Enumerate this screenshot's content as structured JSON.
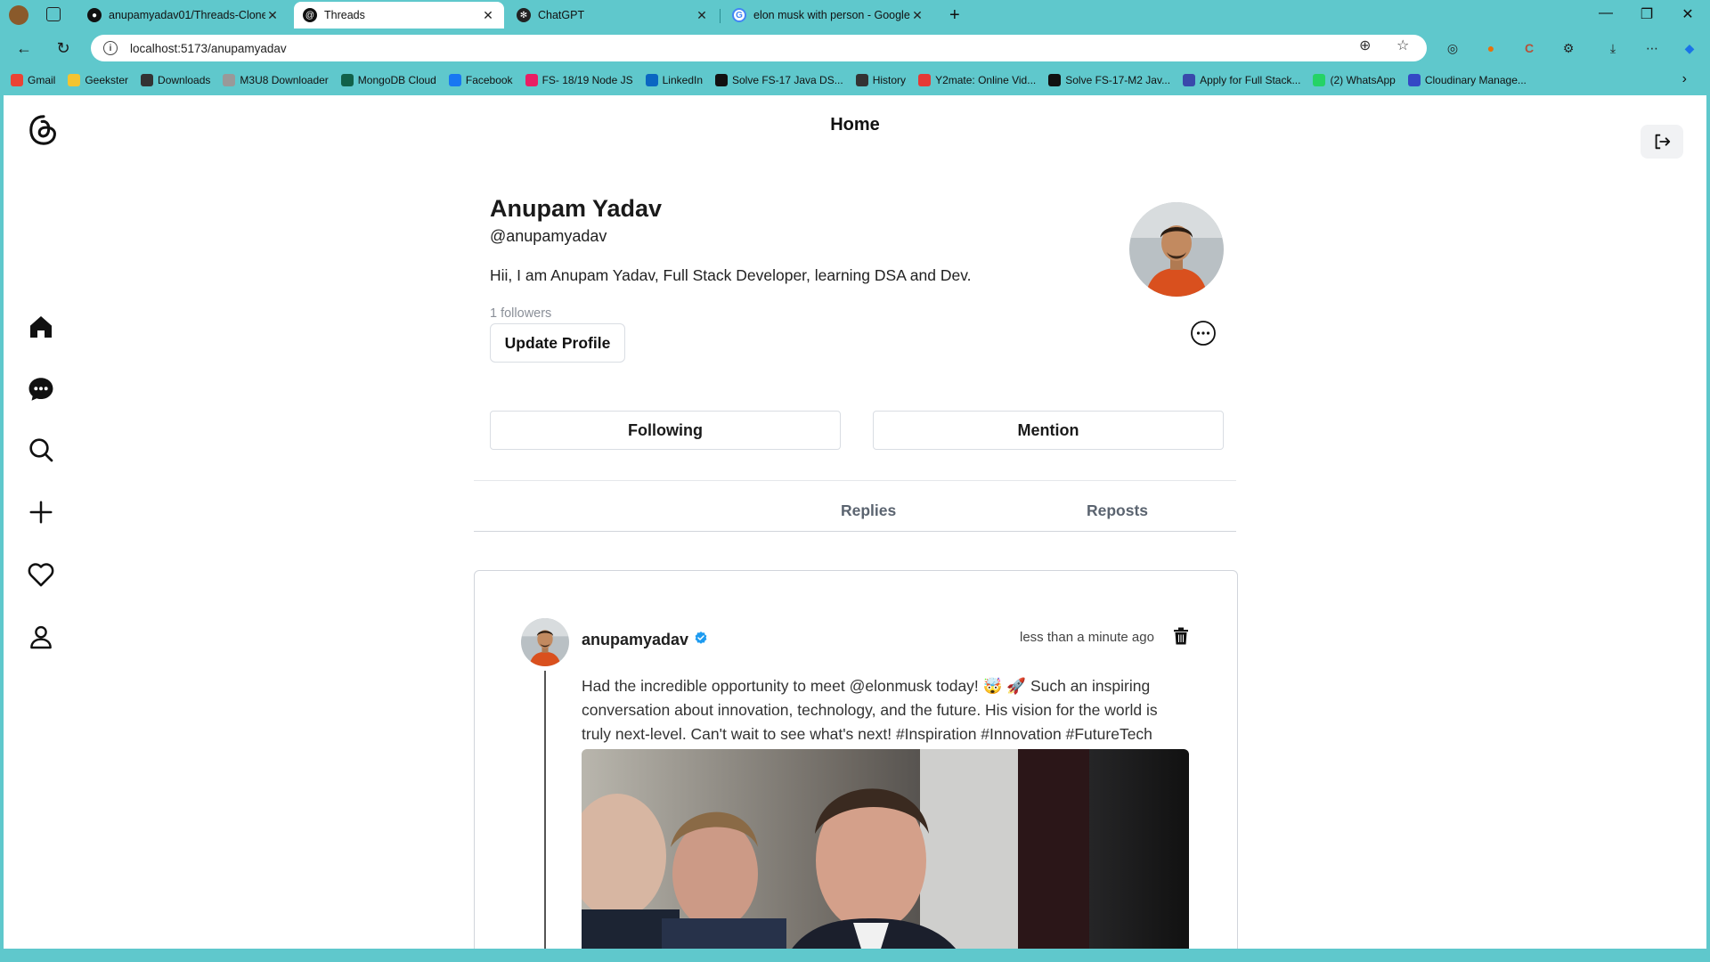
{
  "browser": {
    "tabs": [
      {
        "title": "anupamyadav01/Threads-Clone",
        "favicon": "github-icon"
      },
      {
        "title": "Threads",
        "favicon": "threads-icon",
        "active": true
      },
      {
        "title": "ChatGPT",
        "favicon": "chatgpt-icon"
      },
      {
        "title": "elon musk with person - Google S",
        "favicon": "google-icon"
      }
    ],
    "new_tab_label": "+",
    "url": "localhost:5173/anupamyadav",
    "bookmarks": [
      {
        "label": "Gmail",
        "color": "#ea4335"
      },
      {
        "label": "Geekster",
        "color": "#f4c430"
      },
      {
        "label": "Downloads",
        "color": "#333333"
      },
      {
        "label": "M3U8 Downloader",
        "color": "#999999"
      },
      {
        "label": "MongoDB Cloud",
        "color": "#116149"
      },
      {
        "label": "Facebook",
        "color": "#1877f2"
      },
      {
        "label": "FS- 18/19 Node JS",
        "color": "#e91e63"
      },
      {
        "label": "LinkedIn",
        "color": "#0a66c2"
      },
      {
        "label": "Solve FS-17 Java DS...",
        "color": "#111111"
      },
      {
        "label": "History",
        "color": "#333333"
      },
      {
        "label": "Y2mate: Online Vid...",
        "color": "#e53935"
      },
      {
        "label": "Solve FS-17-M2 Jav...",
        "color": "#111111"
      },
      {
        "label": "Apply for Full Stack...",
        "color": "#3949ab"
      },
      {
        "label": "(2) WhatsApp",
        "color": "#25d366"
      },
      {
        "label": "Cloudinary Manage...",
        "color": "#3448c5"
      }
    ]
  },
  "header": {
    "title": "Home"
  },
  "sidebar": {
    "items": [
      {
        "name": "home",
        "icon": "home-icon"
      },
      {
        "name": "chat",
        "icon": "chat-icon"
      },
      {
        "name": "search",
        "icon": "search-icon"
      },
      {
        "name": "create",
        "icon": "plus-icon"
      },
      {
        "name": "activity",
        "icon": "heart-icon"
      },
      {
        "name": "profile",
        "icon": "user-icon"
      }
    ]
  },
  "profile": {
    "name": "Anupam Yadav",
    "handle": "@anupamyadav",
    "bio": "Hii, I am Anupam Yadav, Full Stack Developer, learning DSA and Dev.",
    "followers": "1 followers",
    "update_label": "Update Profile",
    "following_label": "Following",
    "mention_label": "Mention"
  },
  "tabs": {
    "replies": "Replies",
    "reposts": "Reposts"
  },
  "post": {
    "username": "anupamyadav",
    "time": "less than a minute ago",
    "text": "Had the incredible opportunity to meet @elonmusk today! 🤯 🚀 Such an inspiring conversation about innovation, technology, and the future. His vision for the world is truly next-level. Can't wait to see what's next! #Inspiration #Innovation #FutureTech"
  },
  "colors": {
    "browser_chrome": "#5fc8cc",
    "verified": "#1d9bf0"
  }
}
